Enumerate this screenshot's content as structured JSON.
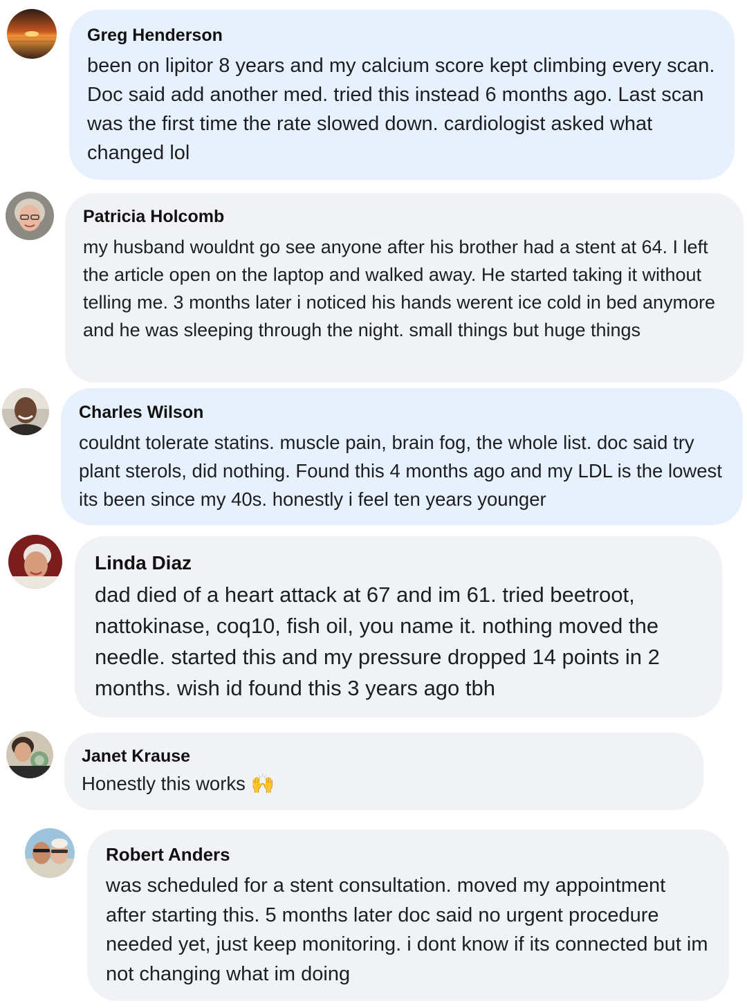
{
  "comments": [
    {
      "author": "Greg Henderson",
      "text": "been on lipitor 8 years and my calcium score kept climbing every scan. Doc said add another med. tried this instead 6 months ago. Last scan was the first time the rate slowed down. cardiologist asked what changed lol",
      "avatar_icon": "sunset-avatar-icon",
      "bubble_color": "#e7f1fd"
    },
    {
      "author": "Patricia Holcomb",
      "text": "my husband wouldnt go see anyone after his brother had a stent at 64. I left the article open on the laptop and walked away. He started taking it without telling me. 3 months later i noticed his hands werent ice cold in bed anymore and he was sleeping through the night. small things but huge things",
      "avatar_icon": "woman-portrait-avatar-icon",
      "bubble_color": "#f0f2f5"
    },
    {
      "author": "Charles Wilson",
      "text": "couldnt tolerate statins. muscle pain, brain fog, the whole list. doc said try plant sterols, did nothing. Found this 4 months ago and my LDL is the lowest its been since my 40s. honestly i feel ten years younger",
      "avatar_icon": "man-portrait-avatar-icon",
      "bubble_color": "#e7f1fd"
    },
    {
      "author": "Linda Diaz",
      "text": "dad died of a heart attack at 67 and im 61. tried beetroot, nattokinase, coq10, fish oil, you name it. nothing moved the needle. started this and my pressure dropped 14 points in 2 months. wish id found this 3 years ago tbh",
      "avatar_icon": "woman-portrait-avatar-icon",
      "bubble_color": "#f0f2f5"
    },
    {
      "author": "Janet Krause",
      "text": "Honestly this works",
      "emoji": "🙌",
      "avatar_icon": "woman-portrait-avatar-icon",
      "bubble_color": "#f0f2f5"
    },
    {
      "author": "Robert Anders",
      "text": "was scheduled for a stent consultation. moved my appointment after starting this. 5 months later doc said no urgent procedure needed yet, just keep monitoring. i dont know if its connected but im not changing what im doing",
      "avatar_icon": "couple-portrait-avatar-icon",
      "bubble_color": "#f0f2f5"
    }
  ]
}
